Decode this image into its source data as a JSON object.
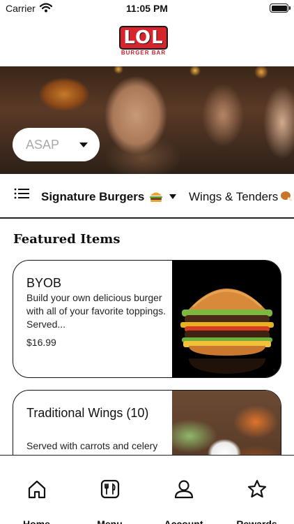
{
  "status_bar": {
    "carrier": "Carrier",
    "time": "11:05 PM"
  },
  "brand": {
    "logo_text": "LOL",
    "logo_subtext": "BURGER BAR",
    "primary_color": "#d8242c"
  },
  "order_time": {
    "value": "ASAP"
  },
  "categories": {
    "active": {
      "label": "Signature Burgers",
      "icon": "burger-icon"
    },
    "next": {
      "label": "Wings & Tenders",
      "icon": "drumstick-icon"
    }
  },
  "section_title": "Featured Items",
  "featured_items": [
    {
      "name": "BYOB",
      "description": "Build your own delicious burger with all of your favorite toppings. Served...",
      "price": "$16.99",
      "image": "burger-photo"
    },
    {
      "name": "Traditional Wings (10)",
      "description": "Served with carrots and celery",
      "image": "wings-photo"
    }
  ],
  "tabs": [
    {
      "label": "Home",
      "icon": "home-icon"
    },
    {
      "label": "Menu",
      "icon": "menu-icon"
    },
    {
      "label": "Account",
      "icon": "account-icon"
    },
    {
      "label": "Rewards",
      "icon": "star-icon"
    }
  ]
}
